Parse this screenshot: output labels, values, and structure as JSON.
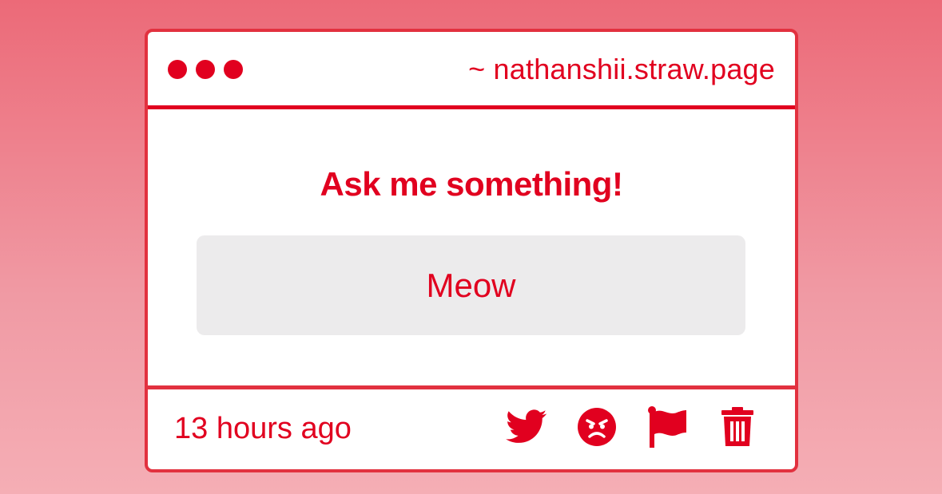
{
  "window": {
    "url": "~ nathanshii.straw.page"
  },
  "question": {
    "prompt": "Ask me something!",
    "answer": "Meow"
  },
  "footer": {
    "timestamp": "13 hours ago",
    "actions": [
      {
        "icon": "twitter-icon"
      },
      {
        "icon": "angry-face-icon"
      },
      {
        "icon": "flag-icon"
      },
      {
        "icon": "trash-icon"
      }
    ]
  },
  "colors": {
    "accent": "#e1001f",
    "border": "#e2313f",
    "answer_bg": "#ecebec",
    "background_top": "#ec6a78",
    "background_bottom": "#f5aeb5"
  }
}
